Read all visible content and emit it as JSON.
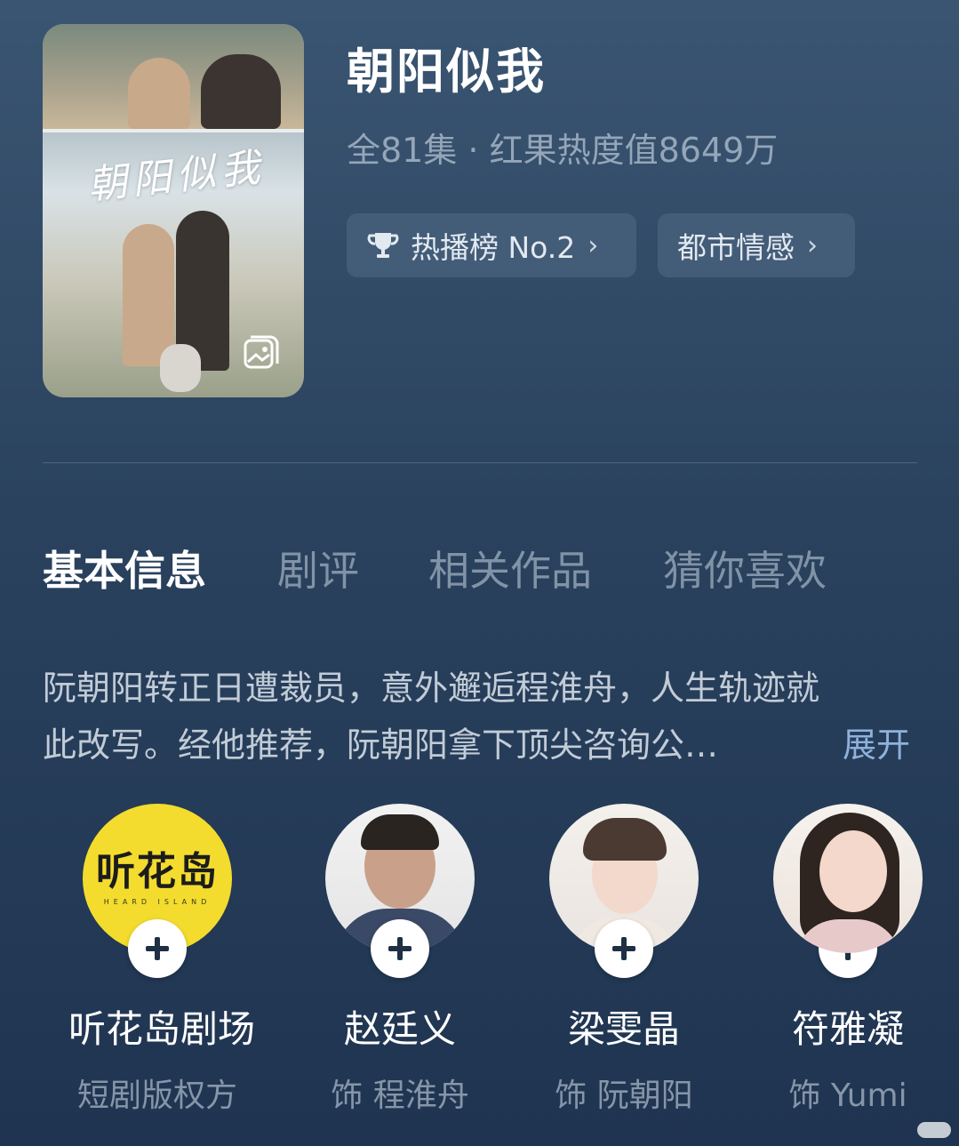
{
  "poster": {
    "calligraphy": "朝阳似我"
  },
  "show": {
    "title": "朝阳似我",
    "meta": "全81集 · 红果热度值8649万"
  },
  "chips": {
    "rank_label": "热播榜 No.2",
    "genre_label": "都市情感"
  },
  "tabs": [
    {
      "label": "基本信息",
      "active": true
    },
    {
      "label": "剧评"
    },
    {
      "label": "相关作品"
    },
    {
      "label": "猜你喜欢"
    }
  ],
  "synopsis": {
    "line1": "阮朝阳转正日遭裁员，意外邂逅程淮舟，人生轨迹就",
    "line2": "此改写。经他推荐，阮朝阳拿下顶尖咨询公…",
    "expand_label": "展开"
  },
  "people": [
    {
      "name": "听花岛剧场",
      "role": "短剧版权方",
      "logo_text": "听花岛",
      "logo_sub": "HEARD ISLAND"
    },
    {
      "name": "赵廷义",
      "role": "饰 程淮舟"
    },
    {
      "name": "梁雯晶",
      "role": "饰 阮朝阳"
    },
    {
      "name": "符雅凝",
      "role": "饰 Yumi"
    }
  ],
  "colors": {
    "background_top": "#3a5572",
    "background_bottom": "#1f3450",
    "link": "#8fb2dc",
    "logo_yellow": "#f3dc2e"
  },
  "icons": {
    "rank": "trophy-icon",
    "chevron": "chevron-right-icon",
    "follow": "plus-icon",
    "poster_badge": "gallery-icon"
  }
}
